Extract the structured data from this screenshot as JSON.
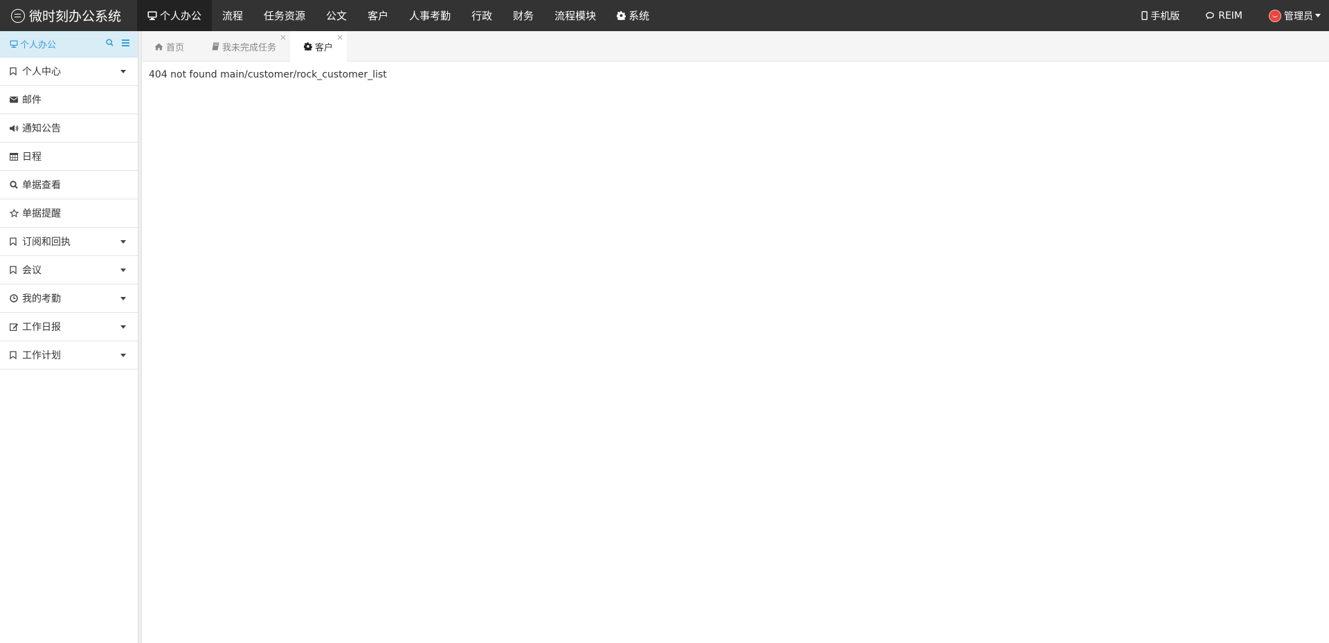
{
  "app": {
    "title": "微时刻办公系统"
  },
  "nav": {
    "items": [
      {
        "label": "个人办公",
        "icon": "monitor-icon",
        "active": true
      },
      {
        "label": "流程"
      },
      {
        "label": "任务资源"
      },
      {
        "label": "公文"
      },
      {
        "label": "客户"
      },
      {
        "label": "人事考勤"
      },
      {
        "label": "行政"
      },
      {
        "label": "财务"
      },
      {
        "label": "流程模块"
      },
      {
        "label": "系统",
        "icon": "gear-icon"
      }
    ],
    "right": {
      "mobile": "手机版",
      "reim": "REIM",
      "user": "管理员"
    }
  },
  "sidebar": {
    "header": "个人办公",
    "items": [
      {
        "label": "个人中心",
        "icon": "bookmark-icon",
        "expandable": true
      },
      {
        "label": "邮件",
        "icon": "envelope-icon"
      },
      {
        "label": "通知公告",
        "icon": "volume-icon"
      },
      {
        "label": "日程",
        "icon": "calendar-icon"
      },
      {
        "label": "单据查看",
        "icon": "search-icon"
      },
      {
        "label": "单据提醒",
        "icon": "star-icon"
      },
      {
        "label": "订阅和回执",
        "icon": "bookmark-icon",
        "expandable": true
      },
      {
        "label": "会议",
        "icon": "bookmark-icon",
        "expandable": true
      },
      {
        "label": "我的考勤",
        "icon": "clock-icon",
        "expandable": true
      },
      {
        "label": "工作日报",
        "icon": "edit-icon",
        "expandable": true
      },
      {
        "label": "工作计划",
        "icon": "bookmark-icon",
        "expandable": true
      }
    ]
  },
  "tabs": [
    {
      "label": "首页",
      "icon": "home-icon",
      "closable": false
    },
    {
      "label": "我未完成任务",
      "icon": "book-icon",
      "closable": true,
      "close": "×"
    },
    {
      "label": "客户",
      "icon": "gear-icon",
      "closable": true,
      "active": true,
      "close": "×"
    }
  ],
  "main": {
    "message": "404 not found main/customer/rock_customer_list"
  },
  "colors": {
    "topbar": "#333333",
    "sidebar_header_bg": "#d9edf7",
    "accent": "#3a9ed8"
  }
}
